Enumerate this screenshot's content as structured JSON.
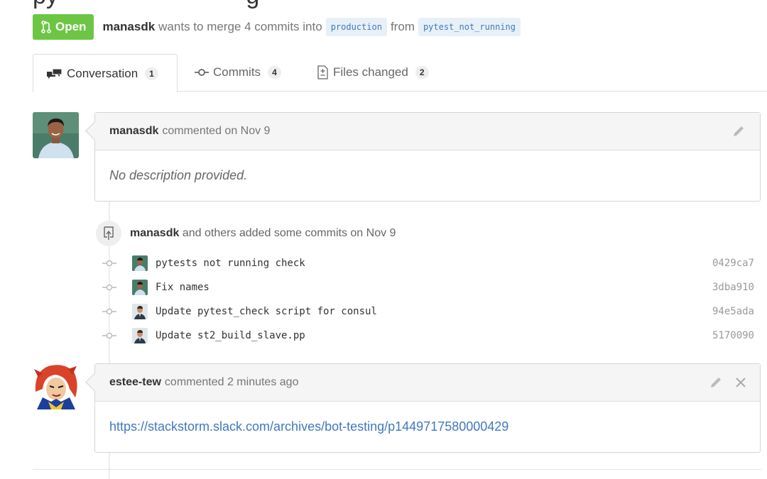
{
  "header": {
    "state_label": "Open",
    "author": "manasdk",
    "text_before": "wants to merge 4 commits into",
    "base_branch": "production",
    "text_from": "from",
    "head_branch": "pytest_not_running"
  },
  "tabs": [
    {
      "label": "Conversation",
      "count": "1"
    },
    {
      "label": "Commits",
      "count": "4"
    },
    {
      "label": "Files changed",
      "count": "2"
    }
  ],
  "comment1": {
    "author": "manasdk",
    "meta": "commented on Nov 9",
    "body": "No description provided."
  },
  "commit_event": {
    "author": "manasdk",
    "text": "and others added some commits on Nov 9"
  },
  "commits": [
    {
      "message": "pytests not running check",
      "sha": "0429ca7"
    },
    {
      "message": "Fix names",
      "sha": "3dba910"
    },
    {
      "message": "Update pytest_check script for consul",
      "sha": "94e5ada"
    },
    {
      "message": "Update st2_build_slave.pp",
      "sha": "5170090"
    }
  ],
  "comment2": {
    "author": "estee-tew",
    "meta": "commented 2 minutes ago",
    "link": "https://stackstorm.slack.com/archives/bot-testing/p1449717580000429"
  },
  "colors": {
    "open_green": "#6cc644",
    "link_blue": "#4078c0"
  }
}
